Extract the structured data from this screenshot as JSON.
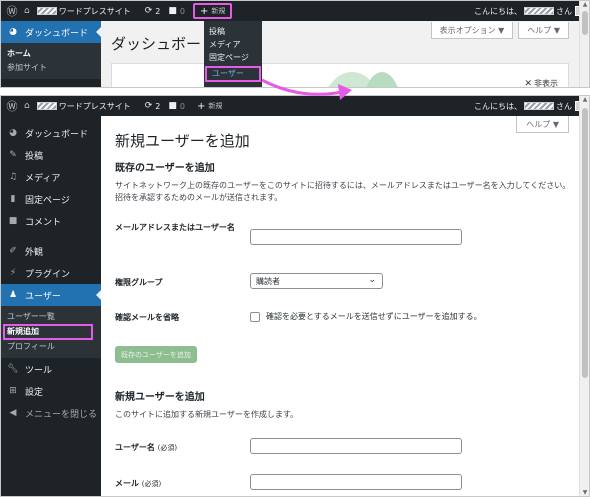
{
  "adminbar": {
    "site_name": "ワードプレスサイト",
    "updates_count": "2",
    "comments_count": "0",
    "new_label": "新規",
    "greeting": "こんにちは、",
    "greeting_suffix": "さん"
  },
  "new_menu": {
    "items": [
      "投稿",
      "メディア",
      "固定ページ"
    ],
    "highlighted": "ユーザー"
  },
  "top_sidebar": {
    "dashboard": "ダッシュボード",
    "home": "ホーム",
    "my_sites": "参加サイト"
  },
  "top_main": {
    "title": "ダッシュボード",
    "screen_options": "表示オプション ▼",
    "help": "ヘルプ ▼",
    "dismiss": "非表示"
  },
  "sidebar": {
    "dashboard": "ダッシュボード",
    "posts": "投稿",
    "media": "メディア",
    "pages": "固定ページ",
    "comments": "コメント",
    "appearance": "外観",
    "plugins": "プラグイン",
    "users": "ユーザー",
    "users_sub": {
      "all_users": "ユーザー一覧",
      "add_new": "新規追加",
      "profile": "プロフィール"
    },
    "tools": "ツール",
    "settings": "設定",
    "collapse": "メニューを閉じる"
  },
  "content": {
    "help": "ヘルプ ▼",
    "page_title": "新規ユーザーを追加",
    "existing_heading": "既存のユーザーを追加",
    "existing_desc_1": "サイトネットワーク上の既存のユーザーをこのサイトに招待するには、メールアドレスまたはユーザー名を入力してください。",
    "existing_desc_2": "招待を承認するためのメールが送信されます。",
    "email_or_username_label": "メールアドレスまたはユーザー名",
    "role_label": "権限グループ",
    "role_value": "購読者",
    "skip_confirm_label": "確認メールを省略",
    "skip_confirm_text": "確認を必要とするメールを送信せずにユーザーを追加する。",
    "add_existing_button": "既存のユーザーを追加",
    "new_heading": "新規ユーザーを追加",
    "new_desc": "このサイトに追加する新規ユーザーを作成します。",
    "username_label": "ユーザー名",
    "email_label": "メール",
    "required": "(必須)"
  },
  "colors": {
    "admin_bar": "#1d2327",
    "menu_active": "#2271b1",
    "highlight": "#e45ce6",
    "disabled_button": "#8ebd90"
  }
}
